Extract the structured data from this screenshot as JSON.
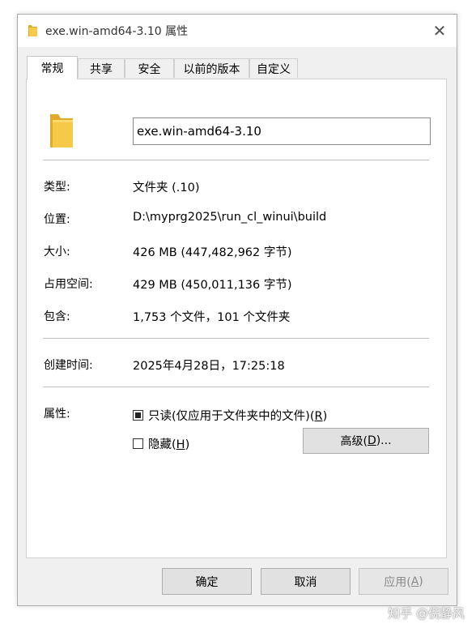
{
  "window": {
    "title": "exe.win-amd64-3.10 属性",
    "close_glyph": "✕"
  },
  "tabs": [
    {
      "label": "常规",
      "active": true
    },
    {
      "label": "共享"
    },
    {
      "label": "安全"
    },
    {
      "label": "以前的版本"
    },
    {
      "label": "自定义"
    }
  ],
  "general": {
    "name_value": "exe.win-amd64-3.10",
    "rows": [
      {
        "label": "类型:",
        "value": "文件夹 (.10)"
      },
      {
        "label": "位置:",
        "value": "D:\\myprg2025\\run_cl_winui\\build"
      },
      {
        "label": "大小:",
        "value": "426 MB (447,482,962 字节)"
      },
      {
        "label": "占用空间:",
        "value": "429 MB (450,011,136 字节)"
      },
      {
        "label": "包含:",
        "value": "1,753 个文件，101 个文件夹"
      }
    ],
    "created_label": "创建时间:",
    "created_value": "2025年4月28日，17:25:18",
    "attributes_label": "属性:",
    "readonly_text": "只读(仅应用于文件夹中的文件)(",
    "readonly_key": "R",
    "readonly_tail": ")",
    "hidden_text": "隐藏(",
    "hidden_key": "H",
    "hidden_tail": ")",
    "advanced_text": "高级(",
    "advanced_key": "D",
    "advanced_tail": ")..."
  },
  "footer": {
    "ok": "确定",
    "cancel": "取消",
    "apply_text": "应用(",
    "apply_key": "A",
    "apply_tail": ")"
  },
  "watermark": "知乎 @倪静风",
  "colors": {
    "folder": "#f7c948",
    "folder_dark": "#e0aa2a"
  }
}
